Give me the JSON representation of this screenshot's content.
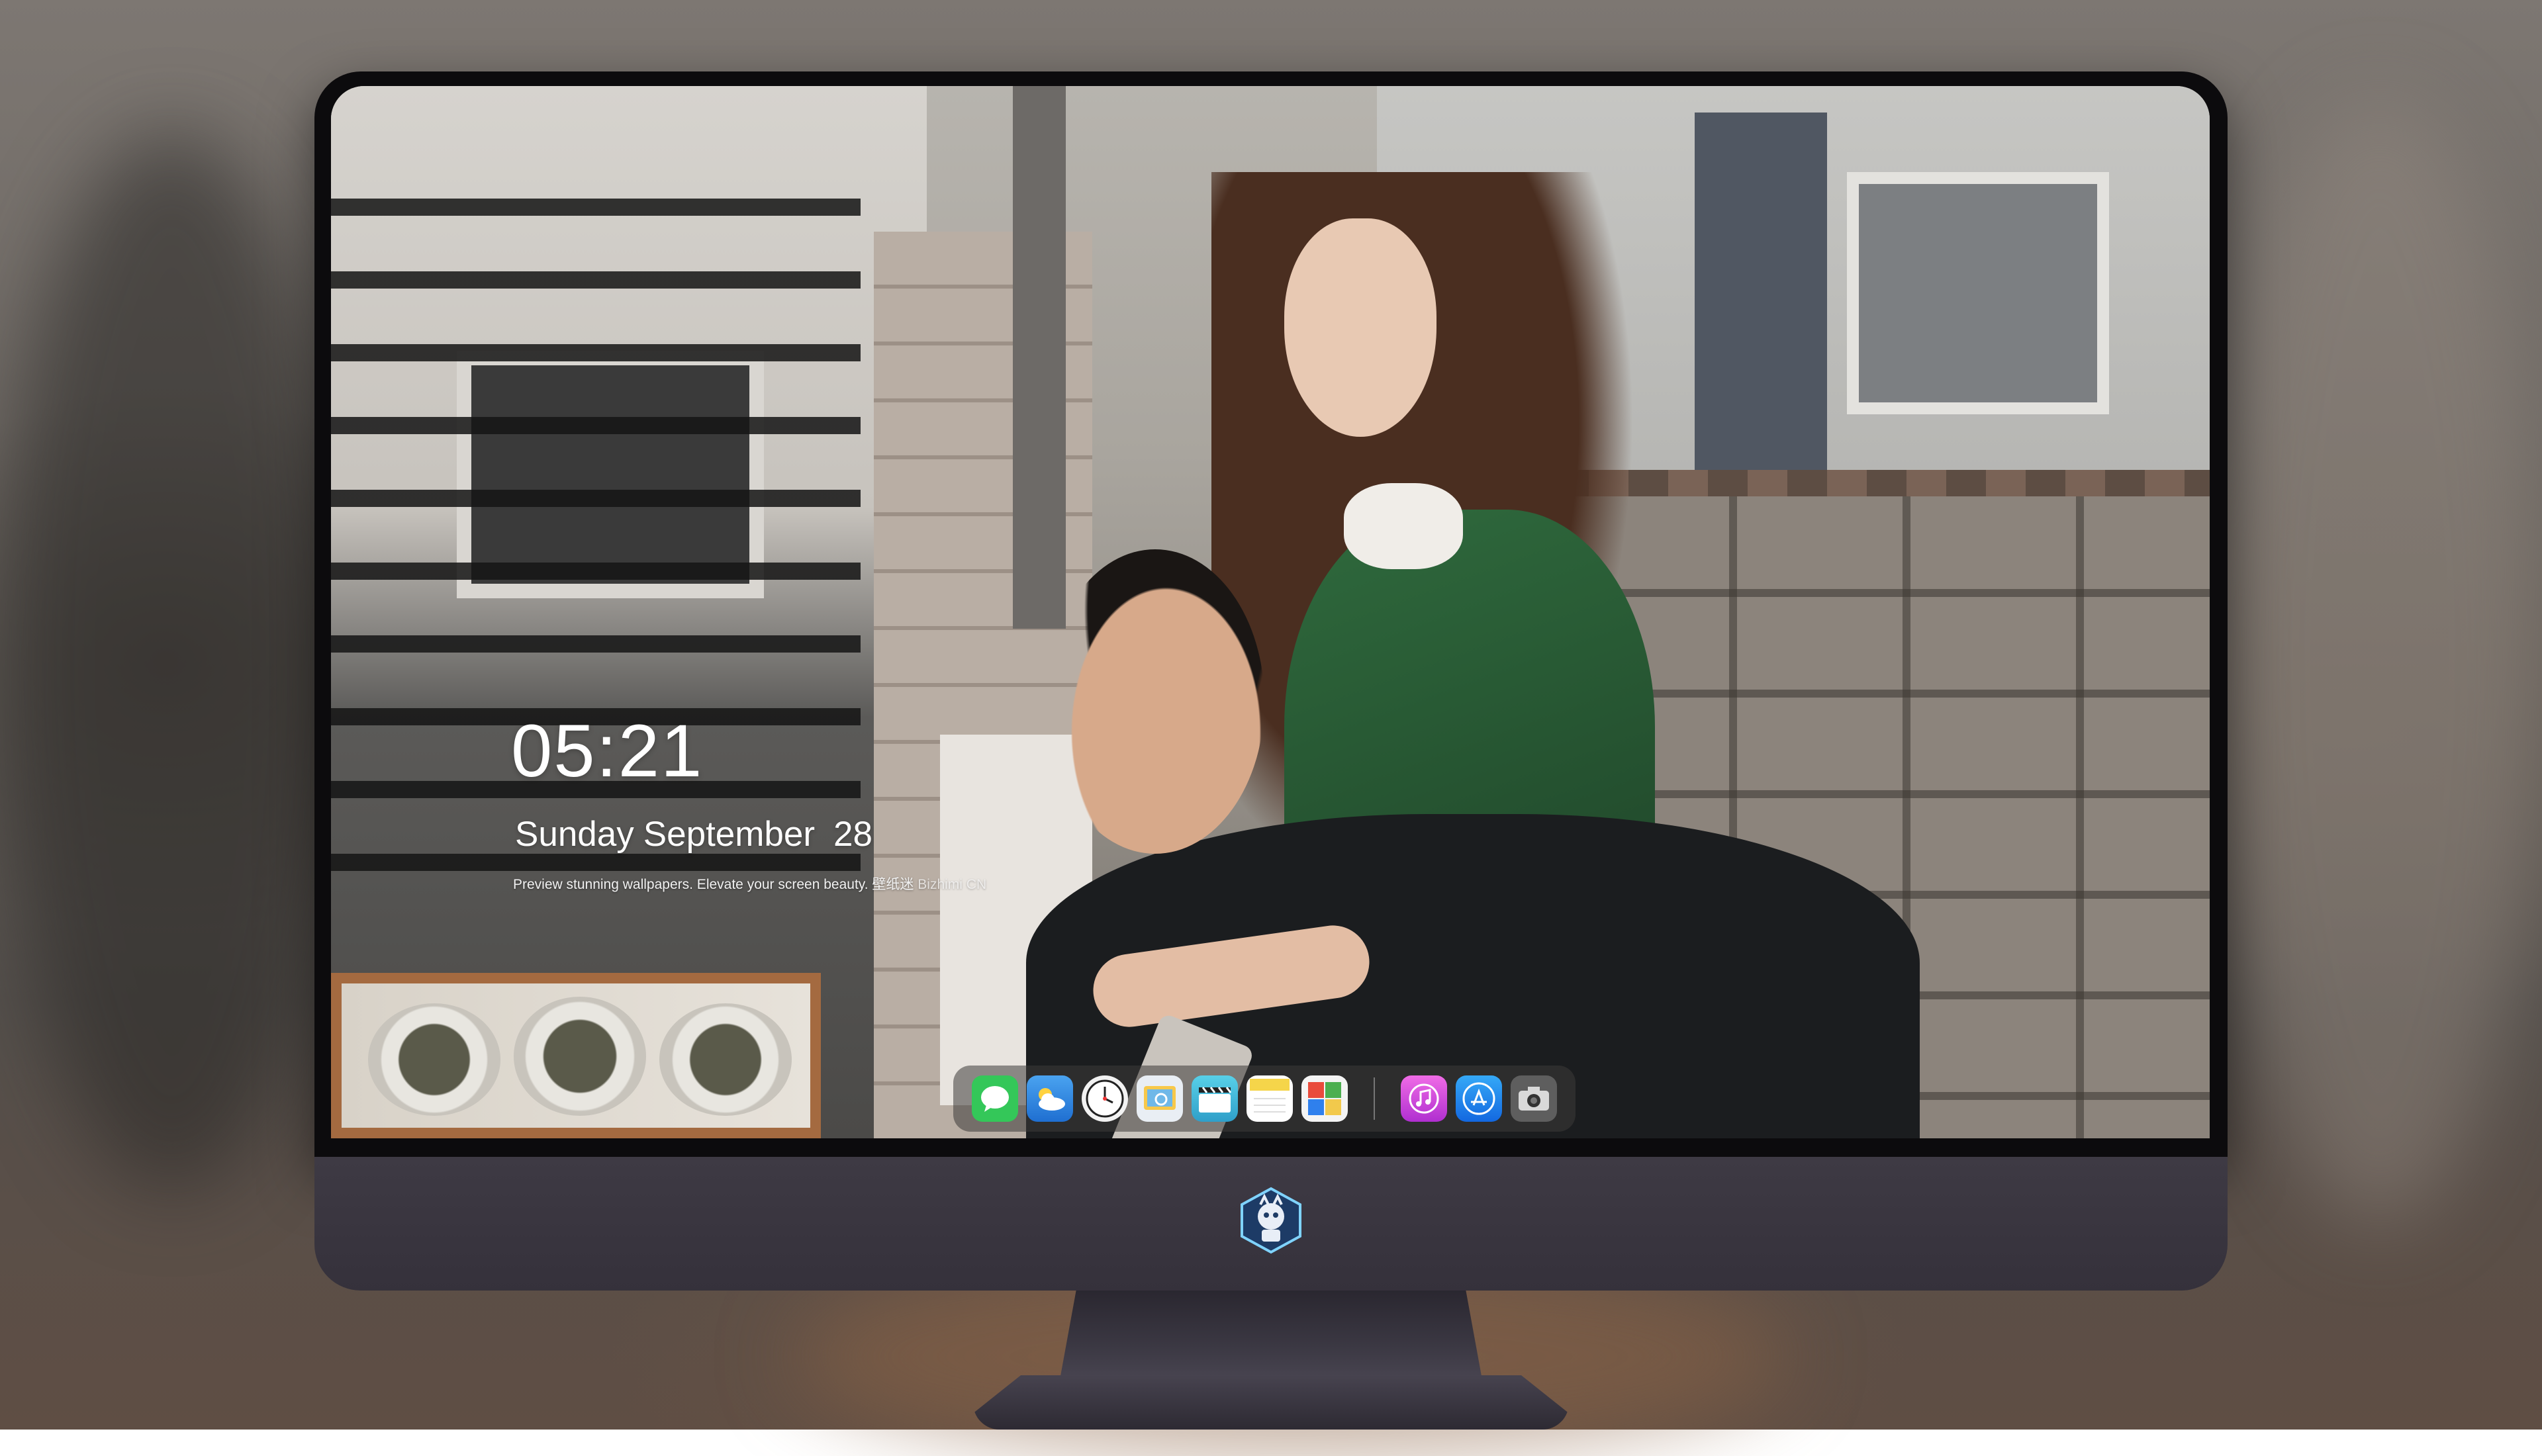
{
  "lock_screen": {
    "time": "05:21",
    "weekday": "Sunday",
    "month": "September",
    "day": "28",
    "tagline": "Preview stunning wallpapers. Elevate your screen beauty.",
    "tagline_cn": "壁纸迷",
    "tagline_brand": "Bizhimi CN"
  },
  "dock": {
    "apps": [
      {
        "name": "messages-icon",
        "color": "#34c759"
      },
      {
        "name": "weather-icon",
        "color": "#3a8ee6"
      },
      {
        "name": "clock-icon",
        "color": "#1c1c1e"
      },
      {
        "name": "preview-icon",
        "color": "#e9eef4"
      },
      {
        "name": "clips-icon",
        "color": "#39b6d8"
      },
      {
        "name": "notes-icon",
        "color": "#f5d54a"
      },
      {
        "name": "photo-booth-icon",
        "color": "#4caf50"
      },
      {
        "name": "itunes-icon",
        "color": "#e14ad8"
      },
      {
        "name": "app-store-icon",
        "color": "#1f7ff0"
      },
      {
        "name": "camera-icon",
        "color": "#6b6b6b"
      }
    ]
  },
  "colors": {
    "bezel": "#0c0b0d",
    "chin": "#3a3640",
    "dock_bg": "rgba(60,58,56,0.55)"
  }
}
